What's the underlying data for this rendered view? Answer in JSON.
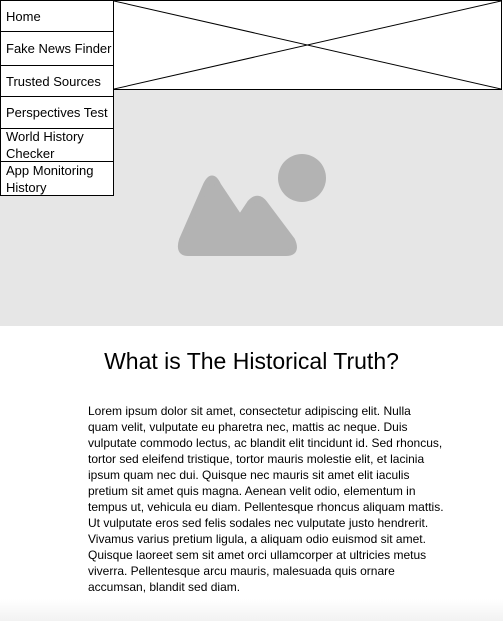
{
  "nav": {
    "items": [
      {
        "label": "Home"
      },
      {
        "label": "Fake News Finder"
      },
      {
        "label": "Trusted Sources"
      },
      {
        "label": "Perspectives Test"
      },
      {
        "label": "World History Checker"
      },
      {
        "label": "App Monitoring History"
      }
    ]
  },
  "banner": {
    "icon": "image-placeholder-x-icon"
  },
  "hero": {
    "icon": "image-placeholder-icon",
    "background": "#e6e6e6",
    "icon_color": "#b3b3b3"
  },
  "content": {
    "title": "What is The Historical Truth?",
    "body": "Lorem ipsum dolor sit amet, consectetur adipiscing elit. Nulla quam velit, vulputate eu pharetra nec, mattis ac neque. Duis vulputate commodo lectus, ac blandit elit tincidunt id. Sed rhoncus, tortor sed eleifend tristique, tortor mauris molestie elit, et lacinia ipsum quam nec dui. Quisque nec mauris sit amet elit iaculis pretium sit amet quis magna. Aenean velit odio, elementum in tempus ut, vehicula eu diam. Pellentesque rhoncus aliquam mattis. Ut vulputate eros sed felis sodales nec vulputate justo hendrerit. Vivamus varius pretium ligula, a aliquam odio euismod sit amet. Quisque laoreet sem sit amet orci ullamcorper at ultricies metus viverra. Pellentesque arcu mauris, malesuada quis ornare accumsan, blandit sed diam."
  }
}
